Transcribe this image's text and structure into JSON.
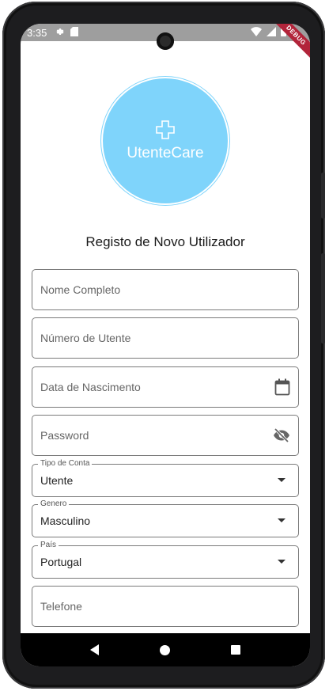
{
  "status_bar": {
    "time": "3:35",
    "debug_label": "DEBUG"
  },
  "logo": {
    "brand": "UtenteCare"
  },
  "page": {
    "title": "Registo de Novo Utilizador"
  },
  "form": {
    "full_name": {
      "placeholder": "Nome Completo"
    },
    "utente_number": {
      "placeholder": "Número de Utente"
    },
    "birth_date": {
      "placeholder": "Data de Nascimento",
      "icon": "calendar-icon"
    },
    "password": {
      "placeholder": "Password",
      "icon": "visibility-off-icon"
    },
    "account_type": {
      "label": "Tipo de Conta",
      "value": "Utente"
    },
    "gender": {
      "label": "Genero",
      "value": "Masculino"
    },
    "country": {
      "label": "País",
      "value": "Portugal"
    },
    "phone": {
      "placeholder": "Telefone"
    }
  },
  "colors": {
    "logo_bg": "#7fd4fb",
    "status_bar": "#9e9e9e",
    "debug_ribbon": "#b2243a"
  }
}
